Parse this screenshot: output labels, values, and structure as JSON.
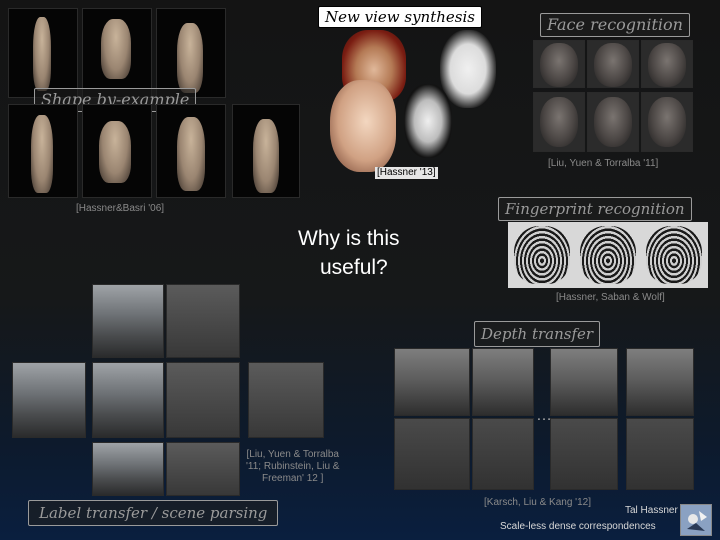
{
  "labels": {
    "new_view_synthesis": "New view synthesis",
    "face_recognition": "Face recognition",
    "shape_by_example": "Shape by-example",
    "fingerprint_recognition": "Fingerprint recognition",
    "depth_transfer": "Depth transfer",
    "label_transfer": "Label transfer / scene parsing"
  },
  "citations": {
    "hassner_13": "[Hassner '13]",
    "liu_yuen_torralba_11": "[Liu, Yuen & Torralba '11]",
    "hassner_basri_06": "[Hassner&Basri '06]",
    "hassner_saban_wolf": "[Hassner, Saban & Wolf]",
    "label_cite_line1": "[Liu, Yuen & Torralba",
    "label_cite_line2": "'11; Rubinstein, Liu &",
    "label_cite_line3": "Freeman' 12 ]",
    "karsch": "[Karsch, Liu & Kang '12]"
  },
  "center_question": {
    "line1": "Why is this",
    "line2": "useful?"
  },
  "ellipsis": "…",
  "footer": {
    "author": "Tal Hassner",
    "subtitle": "Scale-less dense correspondences"
  },
  "icons": [
    "logo-icon"
  ]
}
